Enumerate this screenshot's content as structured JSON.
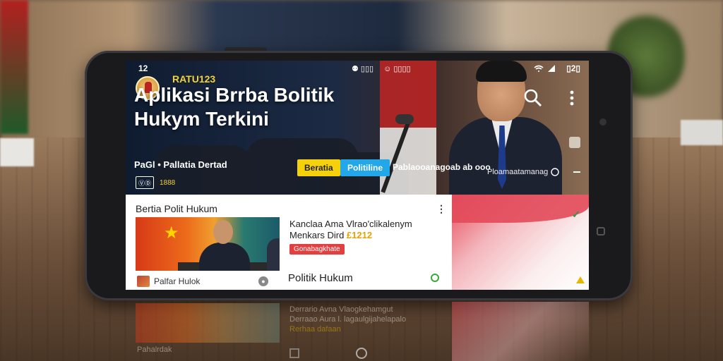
{
  "status_bar": {
    "time": "12",
    "icons_left": "⚉ ▯▯▯",
    "icons_mid": "☺ ▯▯▯▯",
    "battery": "▯2▯"
  },
  "header": {
    "brand": "RATU123",
    "title": "Aplikasi Brrba Bolitik Hukym Terkini"
  },
  "hero": {
    "row_label": "PaGl • Pallatia Dertad",
    "chip_yellow": "Beratia",
    "chip_blue": "Politiline",
    "right_label": "Pablaooanagoab ab ooo",
    "right_label2": "Ploamaatamanag",
    "badge_box": "ⓋⒹ",
    "badge_count": "1888"
  },
  "feed": {
    "section_title": "Bertia Polit Hukum",
    "article_title_line1": "Kanclaa Ama Vlrao'clikalenym",
    "article_title_line2": "Menkars Dird",
    "article_title_highlight": "£1212",
    "red_chip": "Gonabagkhate",
    "footer_left": "Palfar Hulok",
    "footer_middle": "Politik Hukum"
  },
  "reflection": {
    "line1": "Derrario Avna Vlaogkehamgut",
    "line2": "Derraao Aura l. lagaulgijahelapalo",
    "line3": "Rerhaa dafaan",
    "footer": "Pahalrdak"
  },
  "colors": {
    "brand_yellow": "#f2d23a",
    "chip_yellow": "#f4d10a",
    "chip_blue": "#22a8e8",
    "red_chip": "#e24040",
    "accent_pink": "#e84a5a"
  },
  "icons": [
    "search-icon",
    "more-vert-icon",
    "share-icon",
    "bookmark-icon",
    "check-icon",
    "wifi-icon",
    "signal-icon"
  ]
}
